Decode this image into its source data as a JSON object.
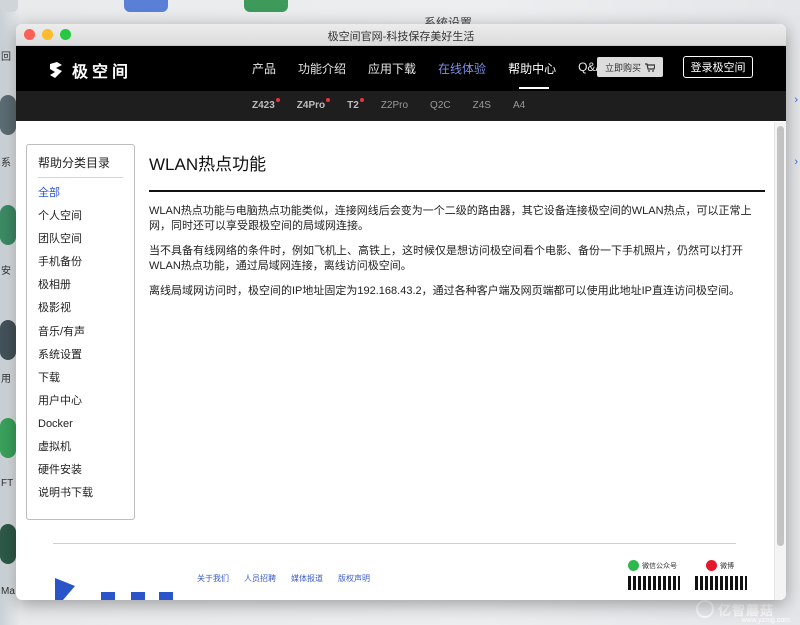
{
  "window": {
    "title": "极空间官网-科技保存美好生活"
  },
  "background": {
    "title_fragment": "系统设置",
    "dock_labels": [
      "回",
      "系",
      "安",
      "用",
      "FT",
      "Ma"
    ]
  },
  "brand": {
    "logo_text": "极空间",
    "accent": "#7f8ee6"
  },
  "topnav": {
    "items": [
      {
        "label": "产品"
      },
      {
        "label": "功能介绍"
      },
      {
        "label": "应用下载"
      },
      {
        "label": "在线体验"
      },
      {
        "label": "帮助中心"
      },
      {
        "label": "Q&A"
      }
    ],
    "buy_label": "立即购买",
    "login_label": "登录极空间"
  },
  "subnav": {
    "items": [
      {
        "label": "Z423"
      },
      {
        "label": "Z4Pro"
      },
      {
        "label": "T2"
      },
      {
        "label": "Z2Pro"
      },
      {
        "label": "Q2C"
      },
      {
        "label": "Z4S"
      },
      {
        "label": "A4"
      }
    ]
  },
  "sidebar": {
    "title": "帮助分类目录",
    "items": [
      {
        "label": "全部"
      },
      {
        "label": "个人空间"
      },
      {
        "label": "团队空间"
      },
      {
        "label": "手机备份"
      },
      {
        "label": "极相册"
      },
      {
        "label": "极影视"
      },
      {
        "label": "音乐/有声"
      },
      {
        "label": "系统设置"
      },
      {
        "label": "下载"
      },
      {
        "label": "用户中心"
      },
      {
        "label": "Docker"
      },
      {
        "label": "虚拟机"
      },
      {
        "label": "硬件安装"
      },
      {
        "label": "说明书下载"
      }
    ]
  },
  "article": {
    "title": "WLAN热点功能",
    "paragraphs": [
      "WLAN热点功能与电脑热点功能类似，连接网线后会变为一个二级的路由器，其它设备连接极空间的WLAN热点，可以正常上网，同时还可以享受跟极空间的局域网连接。",
      "当不具备有线网络的条件时，例如飞机上、高铁上，这时候仅是想访问极空间看个电影、备份一下手机照片，仍然可以打开WLAN热点功能，通过局域网连接，离线访问极空间。",
      "离线局域网访问时，极空间的IP地址固定为192.168.43.2，通过各种客户端及网页端都可以使用此地址IP直连访问极空间。"
    ]
  },
  "footer": {
    "links": [
      {
        "label": "关于我们"
      },
      {
        "label": "人员招聘"
      },
      {
        "label": "媒体报道"
      },
      {
        "label": "版权声明"
      }
    ],
    "wechat_label": "微信公众号",
    "weibo_label": "微博"
  },
  "watermark": {
    "text": "亿智蘑菇",
    "sub": "www.yzmg.com"
  }
}
